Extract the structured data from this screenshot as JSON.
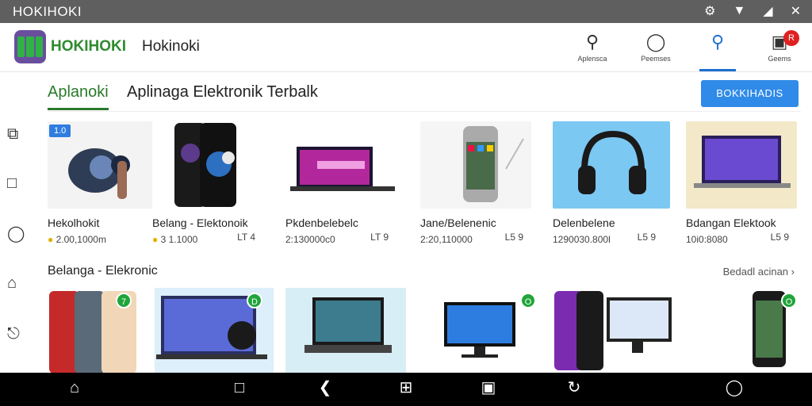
{
  "status_bar": {
    "title": "HOKIHOKI"
  },
  "header": {
    "brand": "HOKIHOKI",
    "app_name": "Hokinoki",
    "icons": [
      {
        "icon": "search-icon",
        "label": "Aplensca"
      },
      {
        "icon": "user-icon",
        "label": "Peemses"
      },
      {
        "icon": "search-active-icon",
        "label": ""
      },
      {
        "icon": "cart-icon",
        "label": "Geems",
        "badge": "R"
      }
    ]
  },
  "tabs": {
    "active": "Aplanoki",
    "title": "Aplinaga Elektronik Terbalk"
  },
  "action_button": "BOKKIHADIS",
  "products": [
    {
      "name": "Hekolhokit",
      "price": "2.00,1000m",
      "rating": "",
      "tag": "1.0",
      "coin": true
    },
    {
      "name": "Belang - Elektonoik",
      "price": "3 1.1000",
      "rating": "LT 4",
      "coin": true
    },
    {
      "name": "Pkdenbelebelc",
      "price": "2:130000c0",
      "rating": "LT 9",
      "coin": false
    },
    {
      "name": "Jane/Belenenic",
      "price": "2:20,110000",
      "rating": "L5 9",
      "coin": false
    },
    {
      "name": "Delenbelene",
      "price": "1290030.800l",
      "rating": "L5 9",
      "coin": false
    },
    {
      "name": "Bdangan Elektook",
      "price": "10i0:8080",
      "rating": "L5 9",
      "coin": false
    }
  ],
  "section2": {
    "title": "Belanga - Elekronic",
    "more": "Bedadl acinan"
  },
  "row2_badges": [
    "7",
    "D",
    "O",
    "O"
  ],
  "colors": {
    "brand_green": "#2e8b2e",
    "accent_blue": "#2f8ae8",
    "badge_red": "#e02020"
  }
}
